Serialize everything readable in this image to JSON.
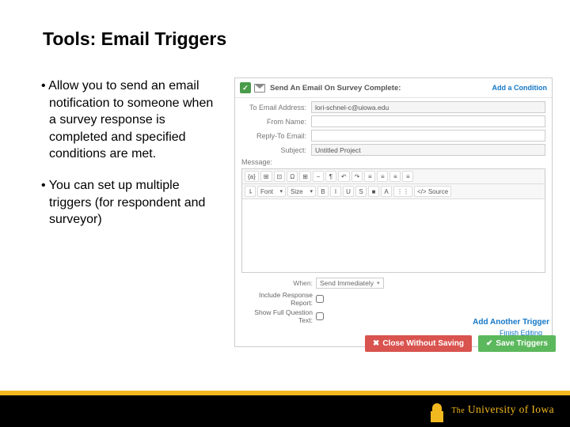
{
  "title": "Tools: Email Triggers",
  "bullets": [
    "Allow you to send an email notification to someone when a survey response is completed and specified conditions are met.",
    "You can set up multiple triggers (for respondent and surveyor)"
  ],
  "panel": {
    "heading": "Send An Email On Survey Complete:",
    "add_condition": "Add a Condition",
    "fields": {
      "to_label": "To Email Address:",
      "to_value": "lori-schnel-c@uiowa.edu",
      "from_label": "From Name:",
      "reply_label": "Reply-To Email:",
      "subject_label": "Subject:",
      "subject_value": "Untitled Project",
      "message_label": "Message:"
    },
    "toolbar1": [
      "{a}",
      "⊞",
      "⊡",
      "Ω",
      "⊞",
      "−",
      "¶",
      "↶",
      "↷",
      "≡",
      "≡",
      "≡",
      "≡"
    ],
    "toolbar2_selects": {
      "font": "Font",
      "size": "Size"
    },
    "toolbar2_btns": [
      "B",
      "I",
      "U",
      "S",
      "■",
      "A",
      "⋮⋮",
      "</>"
    ],
    "toolbar2_source": "Source",
    "when_label": "When:",
    "when_value": "Send Immediately",
    "include_label": "Include Response Report:",
    "show_full_label": "Show Full Question Text:",
    "finish_link": "Finish Editing"
  },
  "add_another": "Add Another Trigger",
  "close_btn": "Close Without Saving",
  "save_btn": "Save Triggers",
  "university_prefix": "The",
  "university": " University of Iowa"
}
